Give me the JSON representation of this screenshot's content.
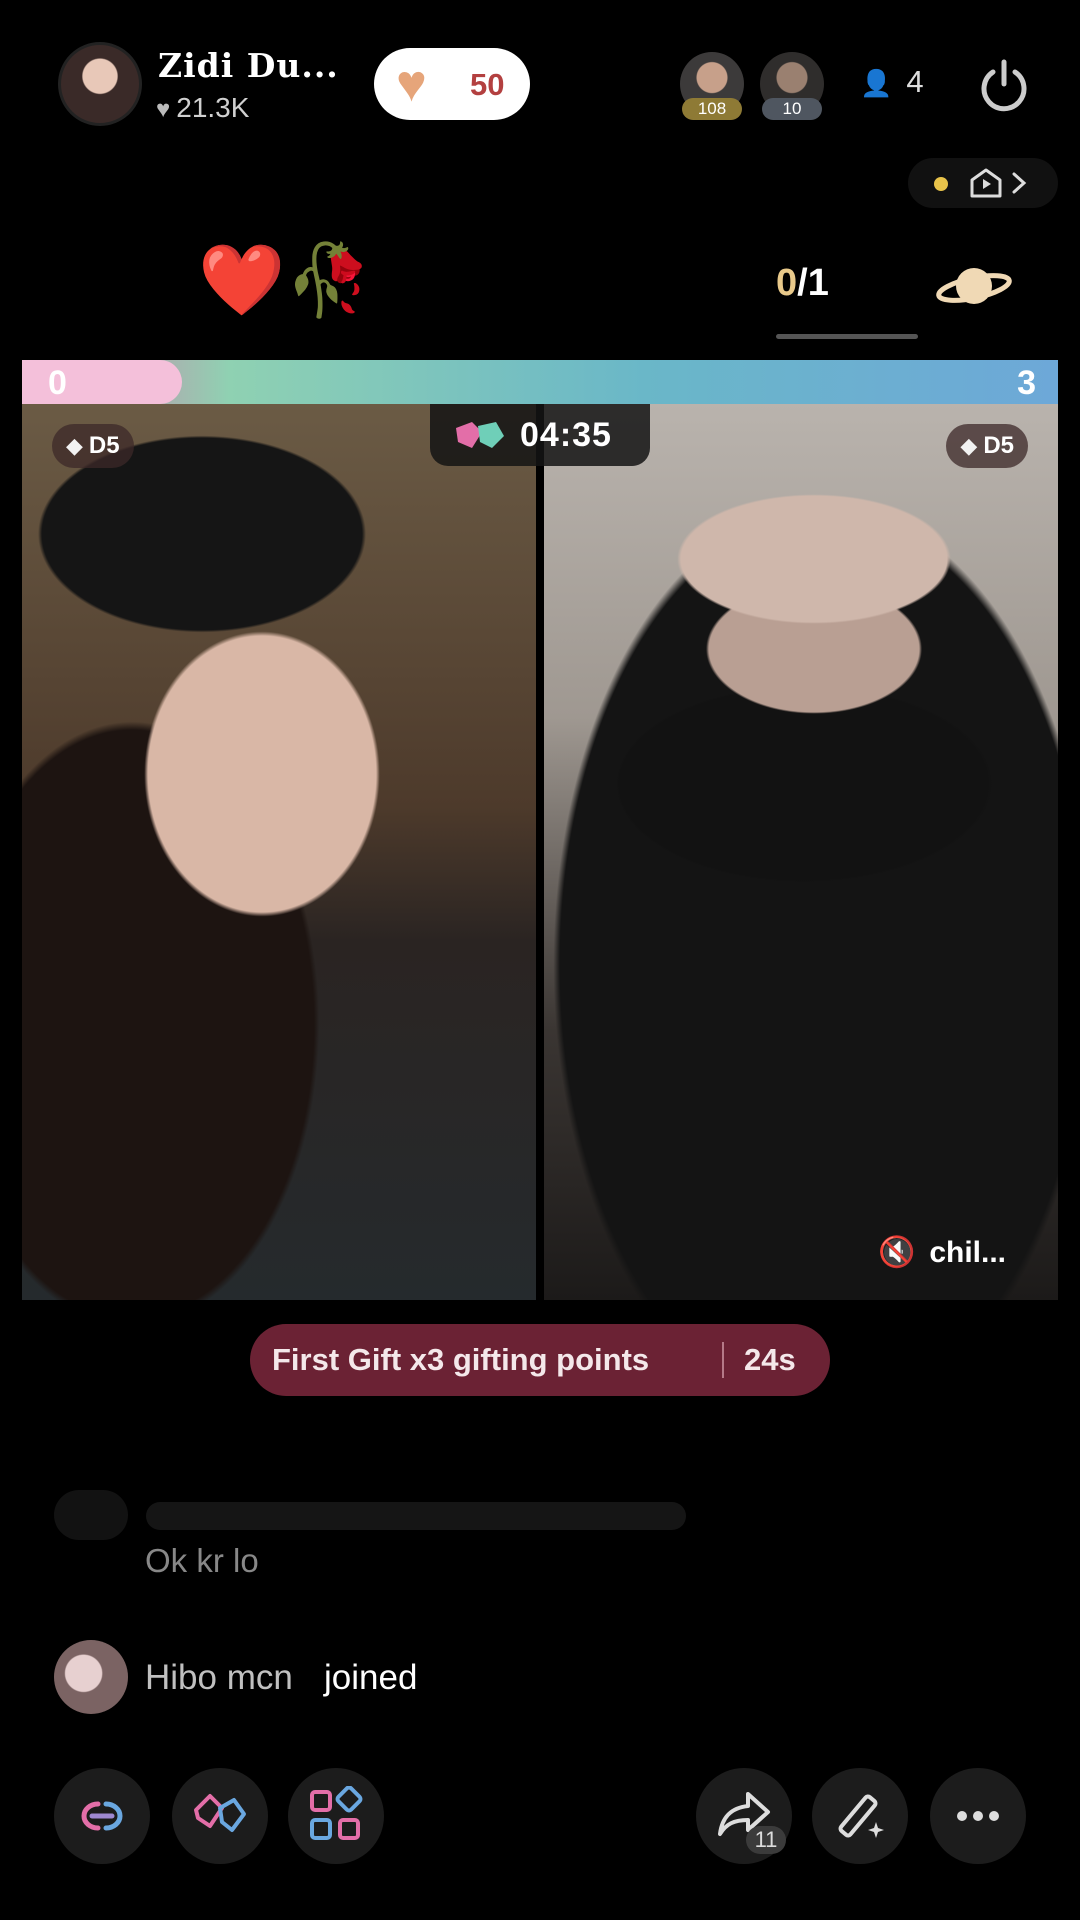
{
  "header": {
    "host_name": "Zidi Du...",
    "host_likes": "21.3K",
    "like_count": "50",
    "viewers": [
      {
        "level": "108"
      },
      {
        "level": "10"
      }
    ],
    "viewer_count": "4"
  },
  "battle": {
    "emojis": "❤️🥀",
    "counter_current": "0",
    "counter_total": "/1",
    "left_score": "0",
    "right_score": "3",
    "timer": "04:35",
    "left_badge": "D5",
    "right_badge": "D5",
    "opponent_label": "chil..."
  },
  "gift_banner": {
    "text": "First Gift x3 gifting points",
    "countdown": "24s"
  },
  "chat": {
    "message": "Ok kr lo",
    "join_user": "Hibo mcn",
    "join_action": "joined"
  },
  "toolbar": {
    "share_count": "11"
  },
  "colors": {
    "accent_pink": "#e36ea8",
    "gift_banner_bg": "#6b2234",
    "like_number": "#b34040"
  }
}
